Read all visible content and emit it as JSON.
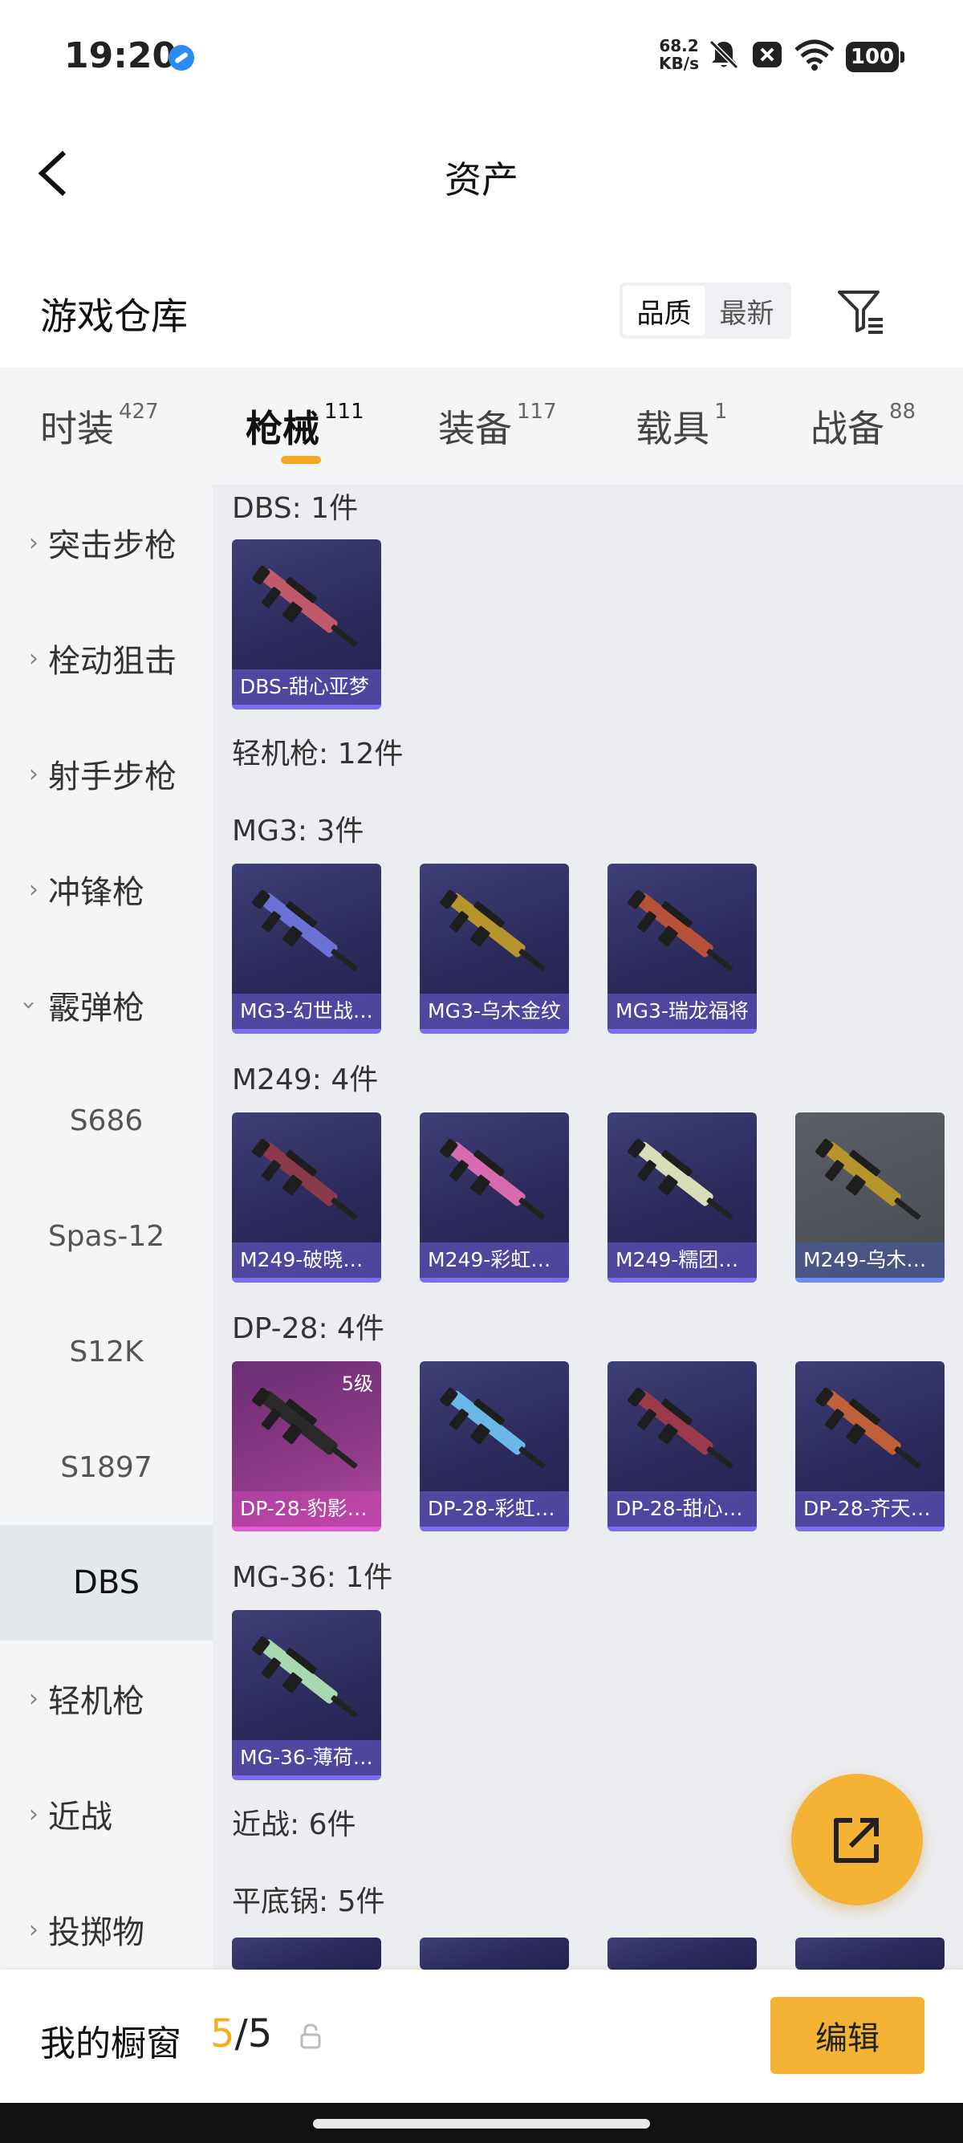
{
  "status_bar": {
    "time": "19:20",
    "net_speed_value": "68.2",
    "net_speed_unit": "KB/s",
    "battery": "100",
    "icons": [
      "browser-app-icon",
      "mute-bell-icon",
      "sim-off-icon",
      "wifi-icon"
    ]
  },
  "nav": {
    "title": "资产",
    "back_icon": "chevron-left-icon"
  },
  "warehouse": {
    "title": "游戏仓库",
    "sort_options": [
      "品质",
      "最新"
    ],
    "sort_selected": "品质",
    "filter_icon": "filter-icon"
  },
  "tabs": [
    {
      "label": "时装",
      "count": "427"
    },
    {
      "label": "枪械",
      "count": "111",
      "active": true
    },
    {
      "label": "装备",
      "count": "117"
    },
    {
      "label": "载具",
      "count": "1"
    },
    {
      "label": "战备",
      "count": "88"
    }
  ],
  "sidebar": {
    "items": [
      "突击步枪",
      "栓动狙击",
      "射手步枪",
      "冲锋枪",
      "霰弹枪",
      "轻机枪",
      "近战",
      "投掷物"
    ],
    "sub_items": [
      "S686",
      "Spas-12",
      "S12K",
      "S1897",
      "DBS"
    ],
    "selected_sub": "DBS"
  },
  "content": {
    "dbs_header": "DBS: 1件",
    "dbs_items": [
      "DBS-甜心亚梦"
    ],
    "lmg_category": "轻机枪: 12件",
    "mg3_header": "MG3: 3件",
    "mg3_items": [
      "MG3-幻世战…",
      "MG3-乌木金纹",
      "MG3-瑞龙福将"
    ],
    "m249_header": "M249: 4件",
    "m249_items": [
      "M249-破晓…",
      "M249-彩虹…",
      "M249-糯团…",
      "M249-乌木…"
    ],
    "dp28_header": "DP-28: 4件",
    "dp28_items": [
      "DP-28-豹影…",
      "DP-28-彩虹…",
      "DP-28-甜心…",
      "DP-28-齐天…"
    ],
    "dp28_level_badge": "5级",
    "mg36_header": "MG-36: 1件",
    "mg36_items": [
      "MG-36-薄荷…"
    ],
    "melee_category": "近战: 6件",
    "pan_header": "平底锅: 5件"
  },
  "fab": {
    "icon": "share-external-icon"
  },
  "bottom_bar": {
    "title": "我的橱窗",
    "count_current": "5",
    "count_sep": "/",
    "count_total": "5",
    "lock_icon": "lock-icon",
    "edit_label": "编辑"
  },
  "colors": {
    "accent": "#f5b335",
    "tab_underline": "#f5a623",
    "card_purple": "#2c2a5a",
    "card_pink": "#8e3a86",
    "card_gray": "#4a4c54"
  }
}
